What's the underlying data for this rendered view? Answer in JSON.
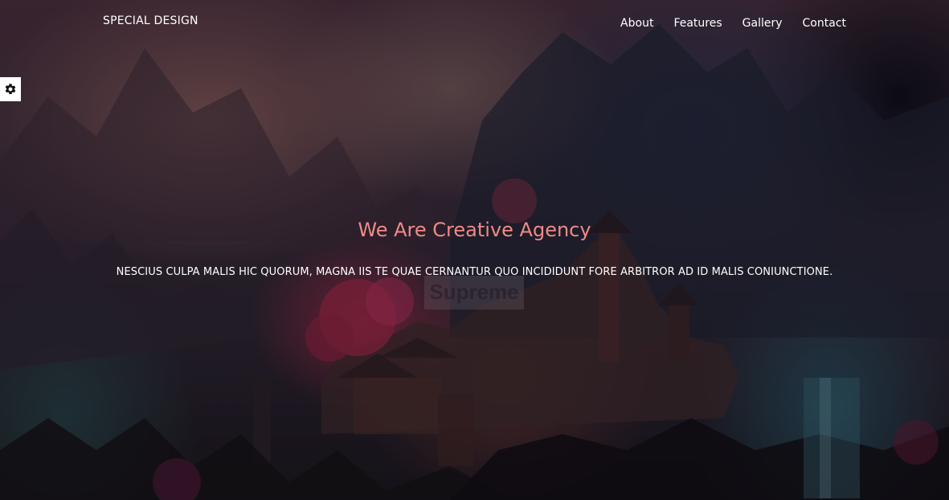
{
  "navbar": {
    "brand": "SPECIAL DESIGN",
    "links": [
      "About",
      "Features",
      "Gallery",
      "Contact"
    ]
  },
  "settings": {
    "icon": "gear-icon"
  },
  "hero": {
    "title": "We Are Creative Agency",
    "subtitle": "NESCIUS CULPA MALIS HIC QUORUM, MAGNA IIS TE QUAE CERNANTUR QUO INCIDIDUNT FORE ARBITROR AD ID MALIS CONIUNCTIONE.",
    "background_label": "Supreme"
  },
  "colors": {
    "title_accent": "#f08a86",
    "nav_text": "#ffffff",
    "text": "#ffffff"
  }
}
